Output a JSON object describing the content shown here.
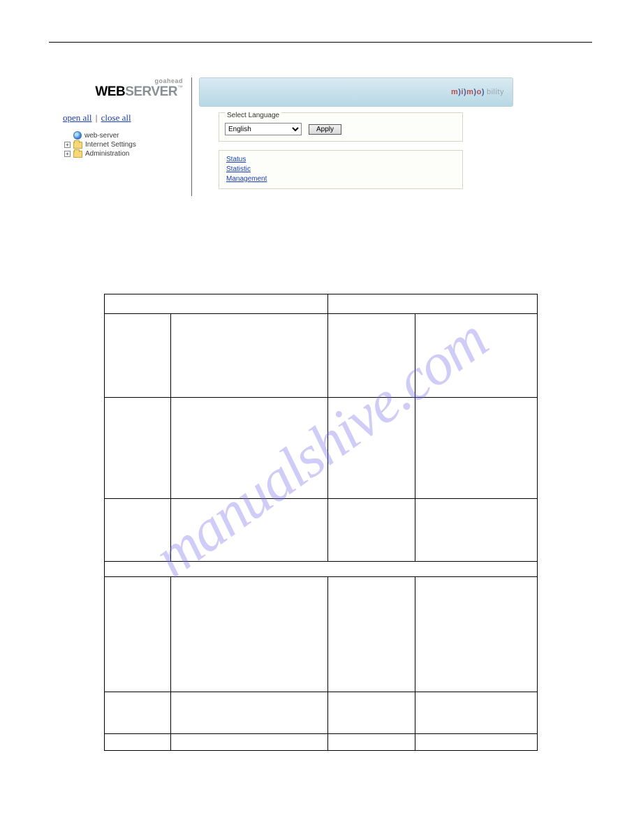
{
  "logo": {
    "tagline": "goahead",
    "brand1": "WEB",
    "brand2": "SERVER",
    "tm": "™"
  },
  "treeLinks": {
    "open": "open all",
    "sep": "|",
    "close": "close all"
  },
  "tree": {
    "item0": "web-server",
    "item1": "Internet Settings",
    "item2": "Administration"
  },
  "banner": {
    "m": "m",
    "i": "i",
    "o": "o",
    "txt": "bility",
    "p": ")"
  },
  "lang": {
    "legend": "Select Language",
    "selected": "English",
    "apply": "Apply"
  },
  "links": {
    "l0": "Status",
    "l1": "Statistic",
    "l2": "Management"
  },
  "watermark": "manualshive.com"
}
